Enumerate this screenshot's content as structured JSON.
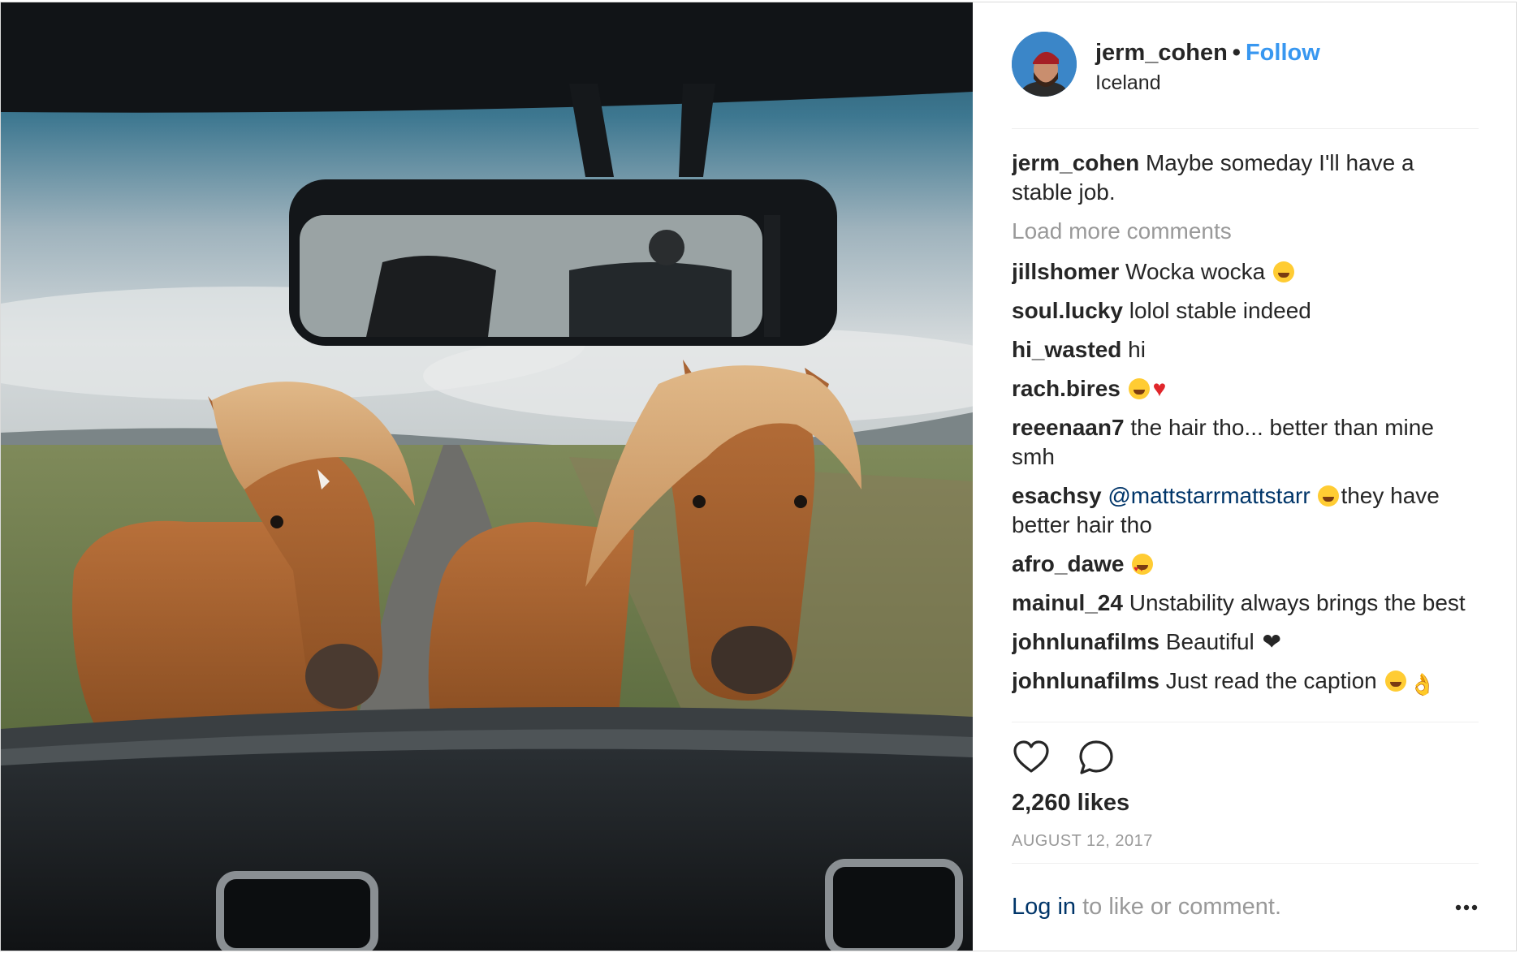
{
  "post": {
    "username": "jerm_cohen",
    "separator": "•",
    "follow_label": "Follow",
    "location": "Iceland",
    "caption_user": "jerm_cohen",
    "caption_text": "Maybe someday I'll have a stable job.",
    "load_more_label": "Load more comments",
    "likes": "2,260 likes",
    "date": "AUGUST 12, 2017",
    "login_link": "Log in",
    "login_rest": "to like or comment."
  },
  "comments": [
    {
      "user": "jillshomer",
      "text": "Wocka wocka",
      "emoji": "grin"
    },
    {
      "user": "soul.lucky",
      "text": "lolol stable indeed"
    },
    {
      "user": "hi_wasted",
      "text": "hi"
    },
    {
      "user": "rach.bires",
      "text": "",
      "emoji": "joy-heart"
    },
    {
      "user": "reeenaan7",
      "text": "the hair tho... better than mine smh"
    },
    {
      "user": "esachsy",
      "mention": "@mattstarrmattstarr",
      "text": "they have better hair tho",
      "emoji": "relieved"
    },
    {
      "user": "afro_dawe",
      "text": "",
      "emoji": "heart-eyes"
    },
    {
      "user": "mainul_24",
      "text": "Unstability always brings the best"
    },
    {
      "user": "johnlunafilms",
      "text": "Beautiful",
      "emoji": "black-heart"
    },
    {
      "user": "johnlunafilms",
      "text": "Just read the caption",
      "emoji": "sweat-ok"
    }
  ],
  "icons": {
    "like": "heart-outline-icon",
    "comment": "speech-bubble-icon",
    "more": "ellipsis-icon"
  },
  "colors": {
    "link_blue": "#3897f0",
    "dark_link": "#003569",
    "muted": "#999999",
    "text": "#262626"
  }
}
